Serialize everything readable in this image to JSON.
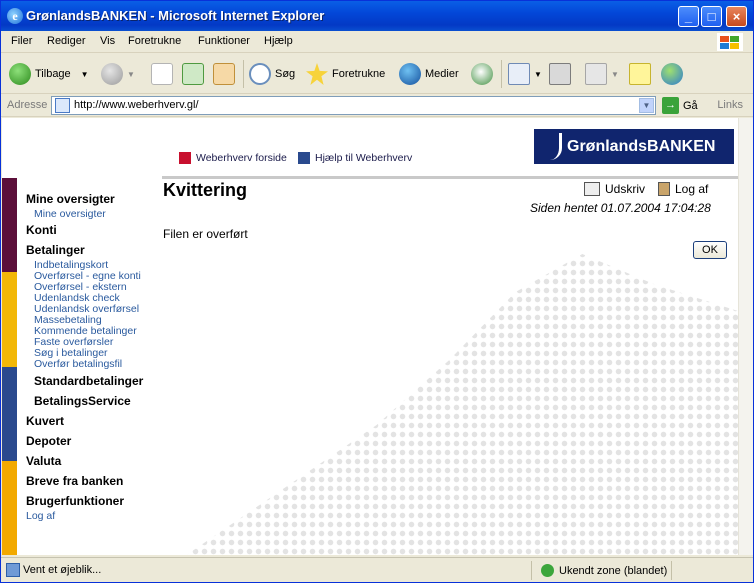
{
  "window": {
    "title": "GrønlandsBANKEN - Microsoft Internet Explorer",
    "buttons": {
      "minimize": "_",
      "maximize": "□",
      "close": "×"
    }
  },
  "menubar": {
    "items": [
      "Filer",
      "Rediger",
      "Vis",
      "Foretrukne",
      "Funktioner",
      "Hjælp"
    ]
  },
  "toolbar": {
    "back": "Tilbage",
    "search": "Søg",
    "favorites": "Foretrukne",
    "media": "Medier"
  },
  "address": {
    "label": "Adresse",
    "url": "http://www.weberhverv.gl/",
    "go": "Gå",
    "links": "Links"
  },
  "site": {
    "top_links": [
      {
        "label": "Weberhverv forside",
        "color": "#c8102e"
      },
      {
        "label": "Hjælp til Weberhverv",
        "color": "#2a4a8e"
      }
    ],
    "logo_text": "GrønlandsBANKEN",
    "page_title": "Kvittering",
    "print_label": "Udskriv",
    "logout_label": "Log af",
    "timestamp": "Siden hentet 01.07.2004 17:04:28",
    "message": "Filen er overført",
    "ok_button": "OK"
  },
  "sidebar": {
    "strip_colors": [
      "#5c0f3a",
      "#f2b707",
      "#2a4a8e",
      "#f2a900"
    ],
    "sections": {
      "mine_oversigter": "Mine oversigter",
      "mine_oversigter_sub": "Mine oversigter",
      "konti": "Konti",
      "betalinger": "Betalinger",
      "betalinger_sub": [
        "Indbetalingskort",
        "Overførsel - egne konti",
        "Overførsel - ekstern",
        "Udenlandsk check",
        "Udenlandsk overførsel",
        "Massebetaling",
        "Kommende betalinger",
        "Faste overførsler",
        "Søg i betalinger",
        "Overfør betalingsfil"
      ],
      "standardbetalinger": "Standardbetalinger",
      "betalingsservice": "BetalingsService",
      "kuvert": "Kuvert",
      "depoter": "Depoter",
      "valuta": "Valuta",
      "breve": "Breve fra banken",
      "brugerfunktioner": "Brugerfunktioner",
      "log_af": "Log af"
    }
  },
  "status": {
    "text": "Vent et øjeblik...",
    "zone": "Ukendt zone (blandet)"
  }
}
